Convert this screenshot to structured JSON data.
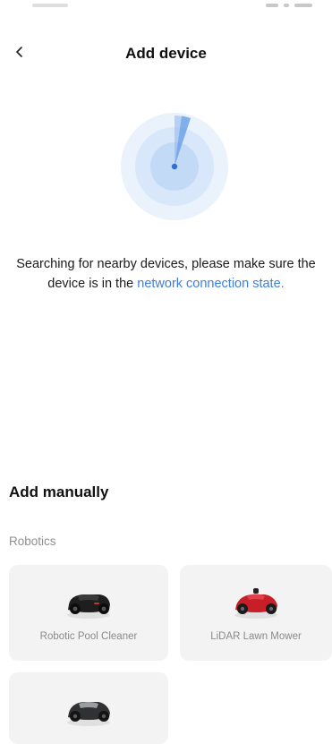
{
  "header": {
    "title": "Add device",
    "back_icon": "chevron-left-icon"
  },
  "search": {
    "text_main": "Searching for nearby devices, please make sure the device is in the ",
    "text_link": "network connection state.",
    "link_color": "#3d7fe0"
  },
  "manual": {
    "title": "Add manually",
    "category": "Robotics",
    "devices": [
      {
        "name": "Robotic Pool Cleaner",
        "icon": "robot-mower-black-icon"
      },
      {
        "name": "LiDAR Lawn Mower",
        "icon": "robot-mower-red-icon"
      },
      {
        "name": "",
        "icon": "robot-mower-gray-icon"
      }
    ]
  },
  "colors": {
    "accent": "#3d7fe0",
    "card_bg": "#f3f3f3",
    "muted_text": "#8f8f8f"
  }
}
